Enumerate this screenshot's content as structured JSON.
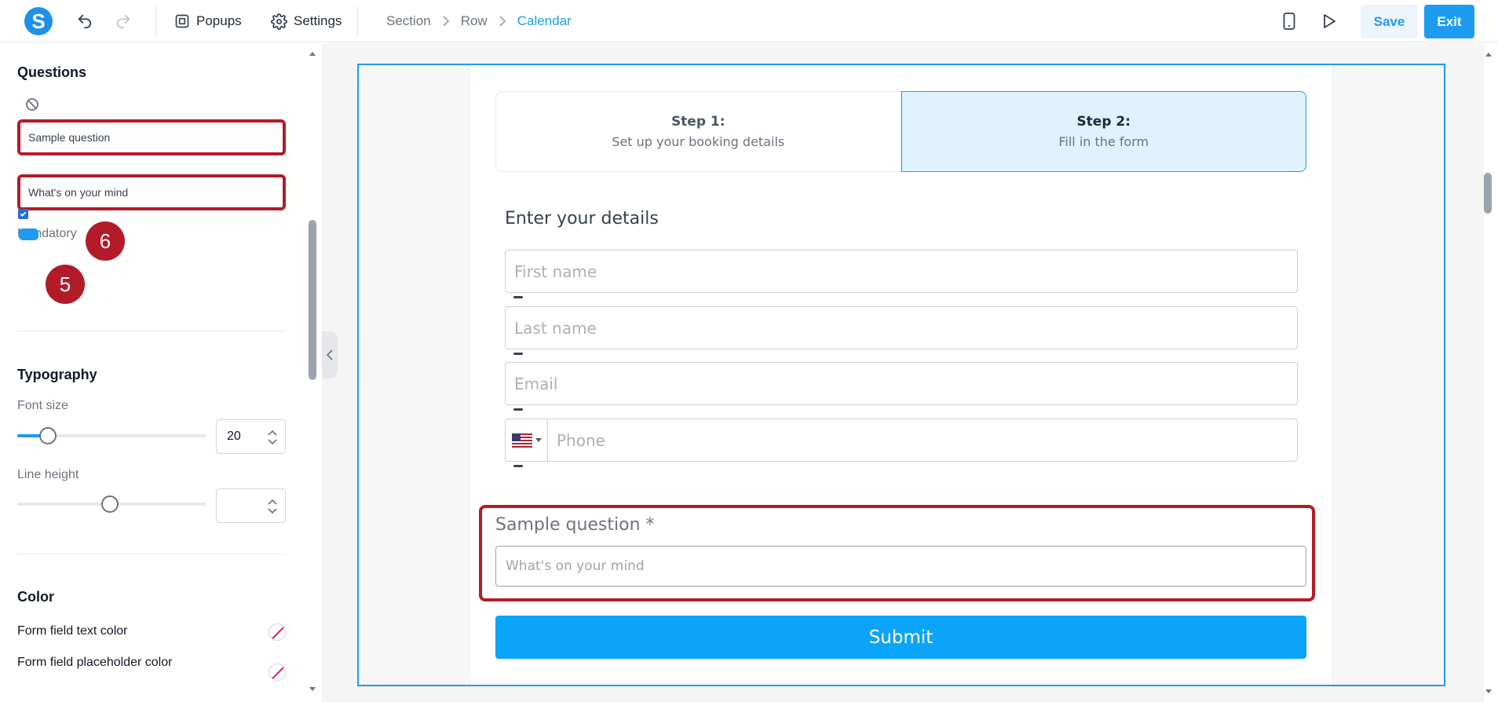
{
  "topbar": {
    "logo_letter": "S",
    "popups_label": "Popups",
    "settings_label": "Settings",
    "breadcrumbs": [
      "Section",
      "Row",
      "Calendar"
    ],
    "save_label": "Save",
    "exit_label": "Exit",
    "icons": [
      "undo-icon",
      "redo-icon",
      "popups-icon",
      "gear-icon",
      "mobile-icon",
      "play-icon"
    ]
  },
  "panel": {
    "questions": {
      "title": "Questions",
      "question_value": "Sample question",
      "placeholder_value": "What's on your mind",
      "mandatory_label": "Mandatory",
      "mandatory_checked": true
    },
    "badges": [
      "6",
      "5"
    ],
    "typography": {
      "title": "Typography",
      "font_size_label": "Font size",
      "font_size_value": "20",
      "line_height_label": "Line height",
      "line_height_value": ""
    },
    "color": {
      "title": "Color",
      "text_color_label": "Form field text color",
      "placeholder_color_label": "Form field placeholder color"
    }
  },
  "canvas": {
    "steps": [
      {
        "title": "Step 1:",
        "subtitle": "Set up your booking details"
      },
      {
        "title": "Step 2:",
        "subtitle": "Fill in the form"
      }
    ],
    "heading": "Enter your details",
    "fields": {
      "first_name": "First name",
      "last_name": "Last name",
      "email": "Email",
      "phone": "Phone"
    },
    "question_label": "Sample question *",
    "question_placeholder": "What's on your mind",
    "submit_label": "Submit"
  },
  "colors": {
    "accent": "#1d9bf0",
    "highlight": "#b31b28",
    "submit": "#0ba4f8"
  }
}
